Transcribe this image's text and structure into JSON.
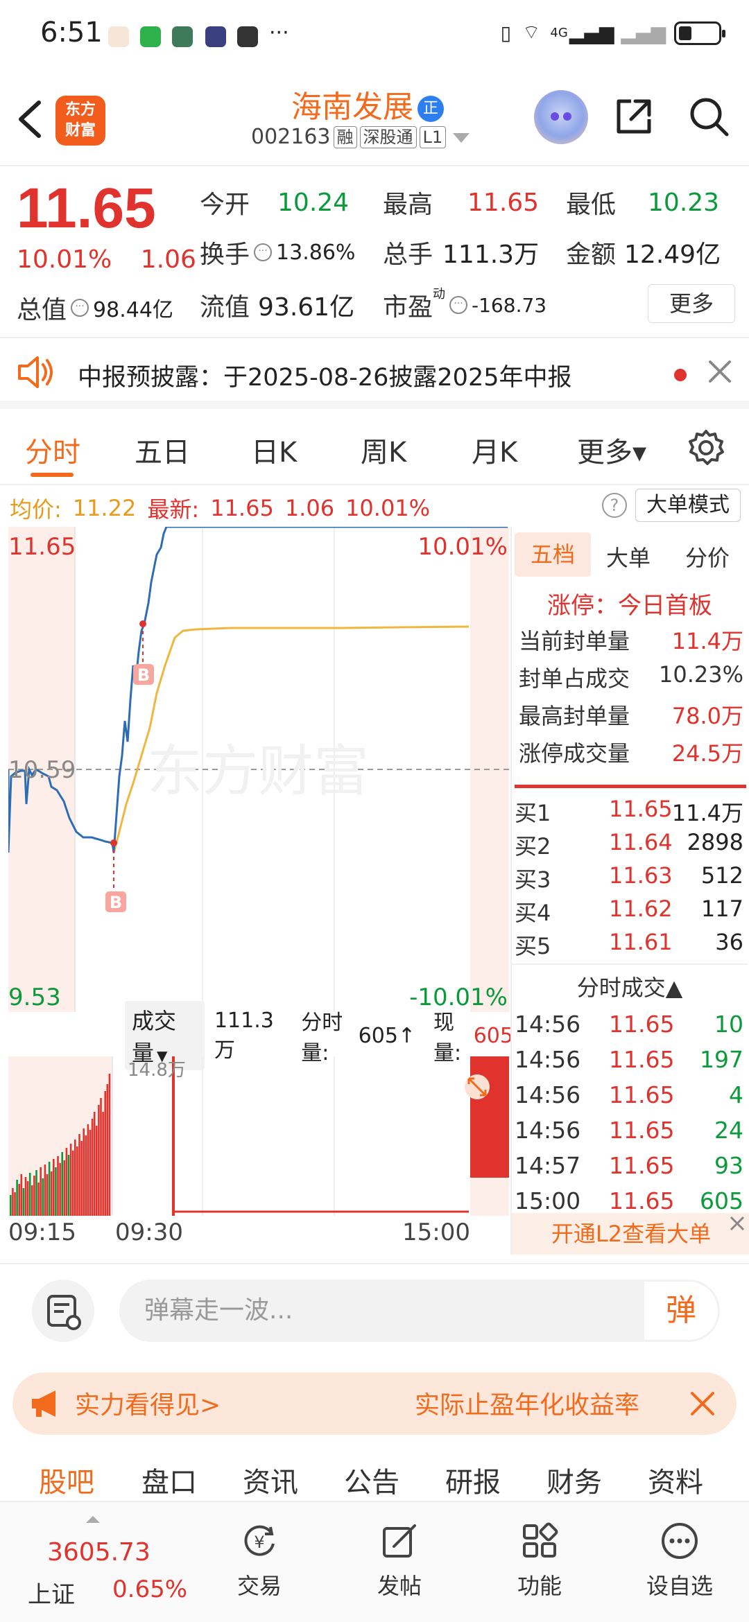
{
  "status_bar": {
    "time": "6:51",
    "more": "···",
    "signal": "4G"
  },
  "header": {
    "back_icon": "back-arrow-icon",
    "logo_line1": "东方",
    "logo_line2": "财富",
    "stock_name": "海南发展",
    "badge": "正",
    "code": "002163",
    "tags": [
      "融",
      "深股通",
      "L1"
    ]
  },
  "quote": {
    "price": "11.65",
    "change_pct": "10.01%",
    "change_amt": "1.06",
    "open_label": "今开",
    "open_val": "10.24",
    "high_label": "最高",
    "high_val": "11.65",
    "low_label": "最低",
    "low_val": "10.23",
    "turnover_label": "换手",
    "turnover_val": "13.86%",
    "volume_label": "总手",
    "volume_val": "111.3万",
    "amount_label": "金额",
    "amount_val": "12.49亿",
    "mktcap_label": "总值",
    "mktcap_val": "98.44亿",
    "float_label": "流值",
    "float_val": "93.61亿",
    "pe_label": "市盈",
    "pe_sup": "动",
    "pe_val": "-168.73",
    "more_label": "更多"
  },
  "notice": {
    "text": "中报预披露：于2025-08-26披露2025年中报"
  },
  "tabs": [
    "分时",
    "五日",
    "日K",
    "周K",
    "月K",
    "更多▾"
  ],
  "info_line": {
    "avg_label": "均价:",
    "avg_val": "11.22",
    "latest_label": "最新:",
    "latest_val": "11.65",
    "latest_amt": "1.06",
    "latest_pct": "10.01%",
    "help": "?",
    "big_order_mode": "大单模式"
  },
  "chart": {
    "y_top": "11.65",
    "y_mid": "10.59",
    "y_bottom": "9.53",
    "pct_top": "10.01%",
    "pct_bottom": "-10.01%",
    "watermark": "东方财富",
    "marker": "B",
    "colors": {
      "price": "#2e6db4",
      "avg": "#f0b640",
      "up": "#e0332d",
      "down": "#0b9a3a"
    }
  },
  "volume": {
    "selector": "成交量",
    "total": "111.3万",
    "intraday_label": "分时量:",
    "intraday_val": "605↑",
    "current_label": "现量:",
    "current_val": "605",
    "peak_label": "14.8万"
  },
  "time_axis": [
    "09:15",
    "09:30",
    "15:00"
  ],
  "right_panel": {
    "tabs": [
      "五档",
      "大单",
      "分价"
    ],
    "limit_title": "涨停：今日首板",
    "limit_rows": [
      {
        "label": "当前封单量",
        "value": "11.4万"
      },
      {
        "label": "封单占成交",
        "value": "10.23%"
      },
      {
        "label": "最高封单量",
        "value": "78.0万"
      },
      {
        "label": "涨停成交量",
        "value": "24.5万"
      }
    ],
    "bids": [
      {
        "label": "买1",
        "price": "11.65",
        "qty": "11.4万"
      },
      {
        "label": "买2",
        "price": "11.64",
        "qty": "2898"
      },
      {
        "label": "买3",
        "price": "11.63",
        "qty": "512"
      },
      {
        "label": "买4",
        "price": "11.62",
        "qty": "117"
      },
      {
        "label": "买5",
        "price": "11.61",
        "qty": "36"
      }
    ],
    "ticks_title": "分时成交▲",
    "ticks": [
      {
        "time": "14:56",
        "price": "11.65",
        "qty": "10"
      },
      {
        "time": "14:56",
        "price": "11.65",
        "qty": "197"
      },
      {
        "time": "14:56",
        "price": "11.65",
        "qty": "4"
      },
      {
        "time": "14:56",
        "price": "11.65",
        "qty": "24"
      },
      {
        "time": "14:57",
        "price": "11.65",
        "qty": "93"
      },
      {
        "time": "15:00",
        "price": "11.65",
        "qty": "605"
      }
    ],
    "l2_label": "开通L2查看大单"
  },
  "comment_bar": {
    "placeholder": "弹幕走一波...",
    "send": "弹"
  },
  "ad_banner": {
    "left_text": "实力看得见>",
    "right_text": "实际止盈年化收益率"
  },
  "bottom_tabs": [
    "股吧",
    "盘口",
    "资讯",
    "公告",
    "研报",
    "财务",
    "资料"
  ],
  "bottom_nav": {
    "index_value": "3605.73",
    "index_name": "上证",
    "index_pct": "0.65%",
    "items": [
      "交易",
      "发帖",
      "功能",
      "设自选"
    ]
  }
}
